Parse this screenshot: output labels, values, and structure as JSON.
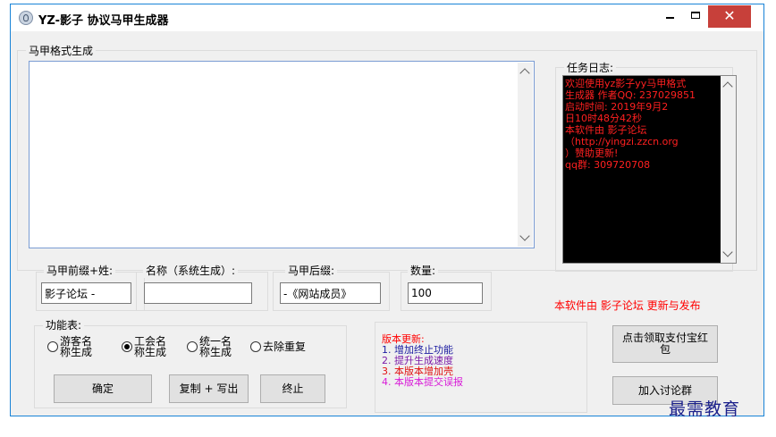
{
  "window": {
    "title": "YZ-影子 协议马甲生成器",
    "close_glyph": "✕"
  },
  "format_group": {
    "label": "马甲格式生成",
    "output_value": ""
  },
  "task_log": {
    "label": "任务日志:",
    "lines": [
      "欢迎使用yz影子yy马甲格式",
      "生成器 作者QQ: 237029851",
      "  启动时间: 2019年9月2",
      "日10时48分42秒",
      "本软件由 影子论坛",
      "（http://yingzi.zzcn.org",
      "）赞助更新!",
      "qq群: 309720708"
    ],
    "text_color": "#ff2020"
  },
  "prefix": {
    "label": "马甲前缀+姓:",
    "value": "影子论坛 -"
  },
  "name": {
    "label": "名称（系统生成）:",
    "value": ""
  },
  "suffix": {
    "label": "马甲后缀:",
    "value": "-《网站成员》"
  },
  "count": {
    "label": "数量:",
    "value": "100"
  },
  "publish_note": "本软件由 影子论坛 更新与发布",
  "functions": {
    "label": "功能表:",
    "radios": [
      {
        "line1": "游客名",
        "line2": "称生成",
        "checked": false
      },
      {
        "line1": "工会名",
        "line2": "称生成",
        "checked": true
      },
      {
        "line1": "统一名",
        "line2": "称生成",
        "checked": false
      },
      {
        "line1": "去除重复",
        "line2": "",
        "checked": false
      }
    ],
    "confirm_button": "确定",
    "copy_button": "复制 + 写出",
    "stop_button": "终止"
  },
  "updates": {
    "title": "版本更新:",
    "items": [
      {
        "text": "1. 增加终止功能",
        "color": "#1a1aa0"
      },
      {
        "text": "2. 提升生成速度",
        "color": "#7a1aa8"
      },
      {
        "text": "3. 本版本增加壳",
        "color": "#e01010"
      },
      {
        "text": "4. 本版本提交误报",
        "color": "#d81ad8"
      }
    ]
  },
  "redpacket_button": {
    "line1": "点击领取支付宝红",
    "line2": "包"
  },
  "join_group_button": "加入讨论群",
  "watermark": "最需教育",
  "colors": {
    "accent": "#1883d7",
    "close": "#c7403a"
  }
}
